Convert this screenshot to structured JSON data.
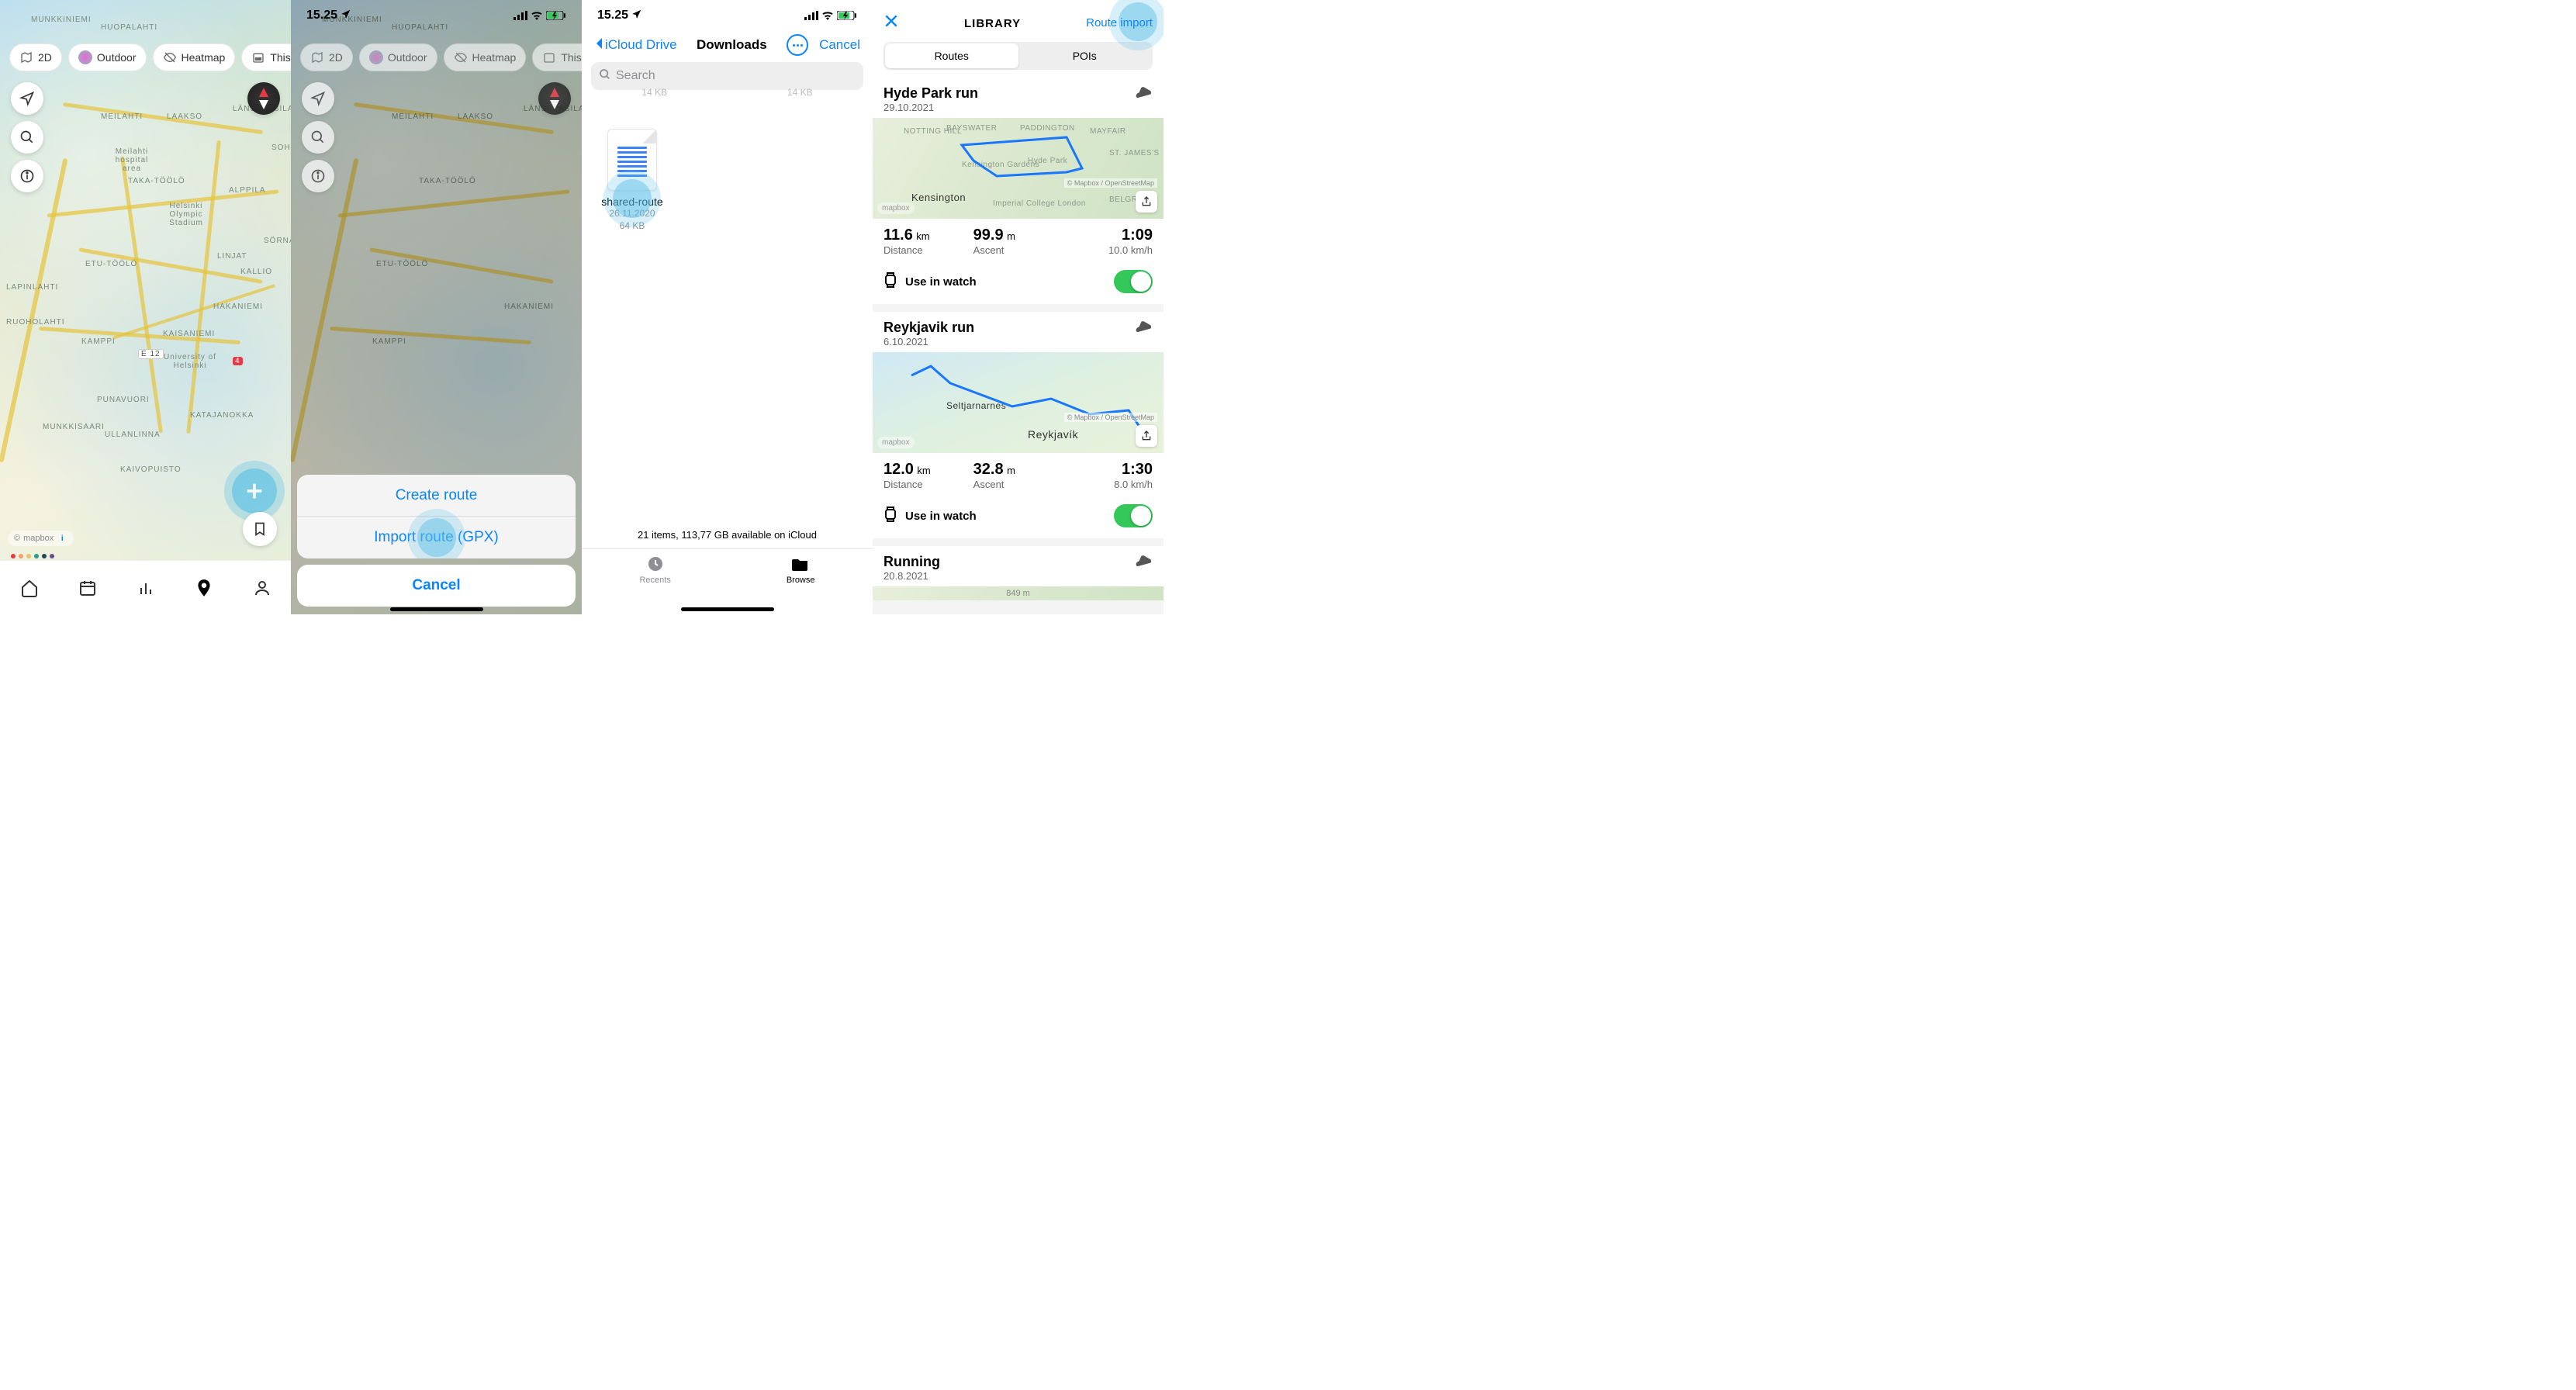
{
  "status": {
    "time": "15.25"
  },
  "screen1": {
    "chips": {
      "mode": "2D",
      "layer": "Outdoor",
      "heat": "Heatmap",
      "period": "This year"
    },
    "labels": [
      "MUNKKINIEMI",
      "HUOPALAHTI",
      "MEILAHTI",
      "LAAKSO",
      "LÄNSI-PASILA",
      "Meilahti hospital area",
      "TAKA-TÖÖLÖ",
      "ETU-TÖÖLÖ",
      "RUOHOLAHTI",
      "ALPPILA",
      "Helsinki Olympic Stadium",
      "LINJAT",
      "KALLIO",
      "HAKANIEMI",
      "KAMPPI",
      "KAISANIEMI",
      "University of Helsinki",
      "PUNAVUORI",
      "MUNKKISAARI",
      "ULLANLINNA",
      "KATAJANOKKA",
      "KAIVOPUISTO",
      "LAPINLAHTI",
      "SÖRNÄINEN",
      "SOHO",
      "E 12",
      "4"
    ],
    "mapbox": "mapbox"
  },
  "screen2": {
    "sheet": {
      "create": "Create route",
      "import": "Import route (GPX)",
      "cancel": "Cancel"
    }
  },
  "screen3": {
    "back": "iCloud Drive",
    "title": "Downloads",
    "cancel": "Cancel",
    "search_placeholder": "Search",
    "ghost_sizes": [
      "14 KB",
      "14 KB"
    ],
    "file": {
      "name": "shared-route",
      "date": "26.11.2020",
      "size": "64 KB"
    },
    "footer": "21 items, 113,77 GB available on iCloud",
    "tabs": {
      "recents": "Recents",
      "browse": "Browse"
    }
  },
  "screen4": {
    "title": "LIBRARY",
    "import": "Route import",
    "seg": {
      "routes": "Routes",
      "pois": "POIs"
    },
    "routes": [
      {
        "title": "Hyde Park run",
        "date": "29.10.2021",
        "map_labels": [
          "NOTTING HILL",
          "BAYSWATER",
          "PADDINGTON",
          "MAYFAIR",
          "ST. JAMES'S",
          "Kensington Gardens",
          "Hyde Park",
          "Kensington",
          "Imperial College London",
          "BELGRAVIA"
        ],
        "attr": "© Mapbox / OpenStreetMap",
        "logo": "mapbox",
        "dist_v": "11.6",
        "dist_u": "km",
        "dist_l": "Distance",
        "asc_v": "99.9",
        "asc_u": "m",
        "asc_l": "Ascent",
        "time_v": "1:09",
        "speed": "10.0 km/h",
        "watch": "Use in watch"
      },
      {
        "title": "Reykjavik run",
        "date": "6.10.2021",
        "map_labels": [
          "Seltjarnarnes",
          "Reykjavík"
        ],
        "attr": "© Mapbox / OpenStreetMap",
        "logo": "mapbox",
        "dist_v": "12.0",
        "dist_u": "km",
        "dist_l": "Distance",
        "asc_v": "32.8",
        "asc_u": "m",
        "asc_l": "Ascent",
        "time_v": "1:30",
        "speed": "8.0 km/h",
        "watch": "Use in watch"
      },
      {
        "title": "Running",
        "date": "20.8.2021",
        "partial_label": "849 m"
      }
    ]
  }
}
